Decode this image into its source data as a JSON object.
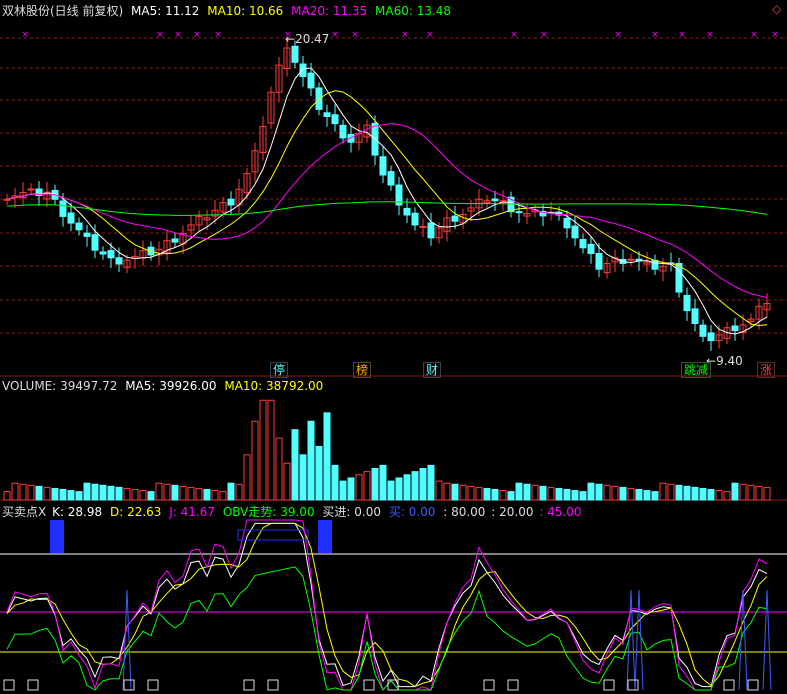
{
  "main": {
    "title": "双林股份(日线 前复权)",
    "ma5_label": "MA5: 11.12",
    "ma10_label": "MA10: 10.66",
    "ma20_label": "MA20: 11.35",
    "ma60_label": "MA60: 13.48",
    "high_marker": "20.47",
    "low_marker": "9.40",
    "tags": [
      "停",
      "榜",
      "财",
      "跳减",
      "涨"
    ],
    "colors": {
      "ma5": "#ffffff",
      "ma10": "#ffff00",
      "ma20": "#ff00ff",
      "ma60": "#00ff00",
      "up": "#ff3c3c",
      "down": "#54ffff"
    }
  },
  "volume": {
    "label": "VOLUME: 39497.72",
    "ma5_label": "MA5: 39926.00",
    "ma10_label": "MA10: 38792.00"
  },
  "indicator": {
    "name": "买卖点X",
    "k_label": "K: 28.98",
    "d_label": "D: 22.63",
    "j_label": "J: 41.67",
    "obv_label": "OBV走势: 39.00",
    "buy_label": "买进: 0.00",
    "buy2_label": "买: 0.00",
    "l80": ": 80.00",
    "l20": ": 20.00",
    "l45": ": 45.00"
  },
  "corner_icon": "diamond-icon"
}
